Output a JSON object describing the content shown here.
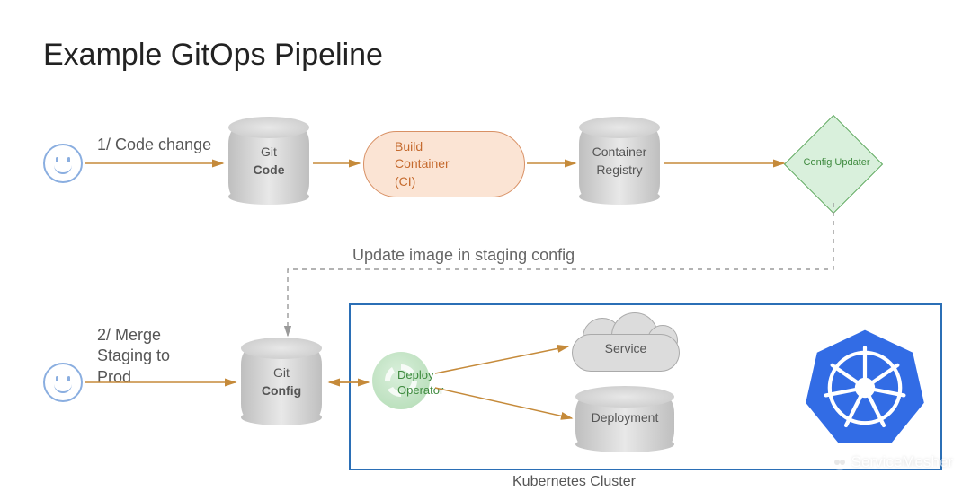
{
  "title": "Example GitOps Pipeline",
  "step1_label": "1/ Code change",
  "step2_label": "2/ Merge\nStaging to\nProd",
  "git_code": {
    "line1": "Git",
    "line2": "Code"
  },
  "git_config": {
    "line1": "Git",
    "line2": "Config"
  },
  "build_ci": "Build\nContainer\n(CI)",
  "container_registry": "Container\nRegistry",
  "config_updater": "Config Updater",
  "update_caption": "Update image in staging config",
  "deploy_operator": "Deploy\nOperator",
  "service": "Service",
  "deployment": "Deployment",
  "cluster_label": "Kubernetes Cluster",
  "watermark": "ServiceMesher",
  "colors": {
    "arrow": "#c58a3a",
    "dashed": "#9a9a9a",
    "cluster_border": "#2b6fb6",
    "k8s": "#326ce5"
  }
}
